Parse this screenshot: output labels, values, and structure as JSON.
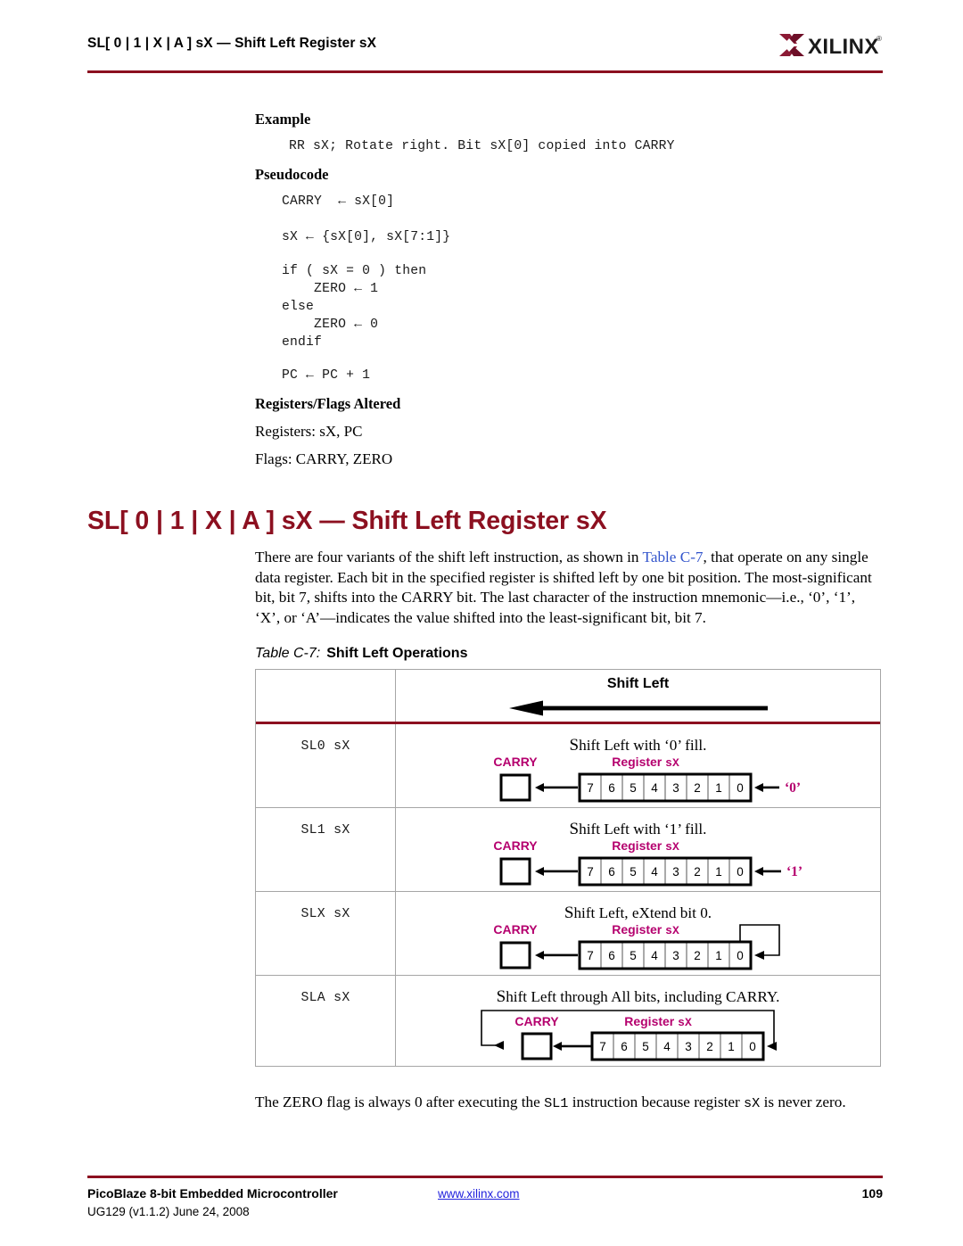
{
  "header": {
    "title": "SL[ 0 | 1 | X | A ] sX — Shift Left Register sX",
    "logo_text": "XILINX",
    "logo_mark": "xilinx-x-mark",
    "rule_color": "#8c1020"
  },
  "example": {
    "heading": "Example",
    "code": "RR sX; Rotate right. Bit sX[0] copied into CARRY"
  },
  "pseudocode": {
    "heading": "Pseudocode",
    "lines": [
      "CARRY  ← sX[0]",
      "sX ← {sX[0], sX[7:1]}",
      "if ( sX = 0 ) then",
      "    ZERO ← 1",
      "else",
      "    ZERO ← 0",
      "endif",
      "PC ← PC + 1"
    ]
  },
  "registers_flags": {
    "heading": "Registers/Flags Altered",
    "registers": "Registers: sX, PC",
    "flags": "Flags: CARRY, ZERO"
  },
  "main": {
    "title": "SL[ 0 | 1 | X | A ] sX — Shift Left Register sX",
    "title_color": "#8c1020",
    "intro_before_link": "There are four variants of the shift left instruction, as shown in ",
    "intro_link": "Table C-7",
    "intro_after_link": ", that operate on any single data register. Each bit in the specified register is shifted left by one bit position. The most-significant bit, bit 7, shifts into the CARRY bit. The last character of the instruction mnemonic—i.e., ‘0’, ‘1’, ‘X’, or ‘A’—indicates the value shifted into the least-significant bit, bit 7.",
    "link_color": "#3355cc",
    "note_part1": "The ZERO flag is always 0 after executing the ",
    "note_code": "SL1",
    "note_part2": " instruction because register ",
    "note_code2": "sX",
    "note_part3": " is never zero."
  },
  "table": {
    "caption_number": "Table C-7:",
    "caption_text": "Shift Left Operations",
    "header_label": "Shift Left",
    "header_arrow": "left-arrow",
    "label_carry": "CARRY",
    "label_register": "Register ",
    "label_register_sub": "sX",
    "bits": [
      "7",
      "6",
      "5",
      "4",
      "3",
      "2",
      "1",
      "0"
    ],
    "accent_color": "#b5006e",
    "rule_color": "#8c1020",
    "border_color": "#a6a6a6",
    "rows": [
      {
        "mnemonic": "SL0 sX",
        "description_prefix": "S",
        "description": "hift Left with ‘0’ fill.",
        "fill_label": "‘0’",
        "diagram": "fill-constant"
      },
      {
        "mnemonic": "SL1 sX",
        "description_prefix": "S",
        "description": "hift Left with ‘1’ fill.",
        "fill_label": "‘1’",
        "diagram": "fill-constant"
      },
      {
        "mnemonic": "SLX sX",
        "description_prefix": "S",
        "description": "hift Left, eXtend bit 0.",
        "fill_label": "",
        "diagram": "extend-bit0"
      },
      {
        "mnemonic": "SLA sX",
        "description_prefix": "S",
        "description": "hift Left through All bits, including CARRY.",
        "fill_label": "",
        "diagram": "through-carry"
      }
    ]
  },
  "footer": {
    "title": "PicoBlaze 8-bit Embedded Microcontroller",
    "doc": "UG129 (v1.1.2) June 24, 2008",
    "url": "www.xilinx.com",
    "page": "109",
    "rule_color": "#8c1020"
  }
}
